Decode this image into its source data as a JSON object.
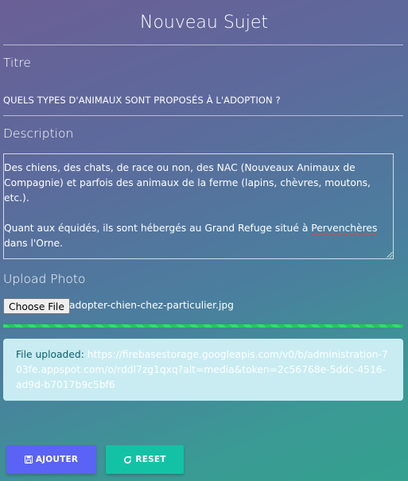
{
  "page": {
    "title": "Nouveau Sujet"
  },
  "form": {
    "titre_label": "Titre",
    "titre_value": "QUELS TYPES D'ANIMAUX SONT PROPOSÉS À L'ADOPTION ?",
    "description_label": "Description",
    "description_p1": "Des chiens, des chats, de race ou non, des NAC (Nouveaux Animaux de Compagnie) et parfois des animaux de la ferme (lapins, chèvres, moutons, etc.).",
    "description_p2_before": "Quant aux équidés, ils sont hébergés au Grand Refuge situé à ",
    "description_p2_misspelled": "Pervenchères",
    "description_p2_after": " dans l'Orne.",
    "upload_label": "Upload Photo",
    "choose_file_label": "Choose File",
    "file_name": "adopter-chien-chez-particulier.jpg",
    "upload_progress_percent": 100
  },
  "alert": {
    "prefix": "File uploaded: ",
    "url": "https://firebasestorage.googleapis.com/v0/b/administration-703fe.appspot.com/o/rddl7zg1qxq?alt=media&token=2c56768e-5ddc-4516-ad9d-b7017b9c5bf6"
  },
  "buttons": {
    "add_label": "AJOUTER",
    "add_icon": "save-icon",
    "reset_label": "RESET",
    "reset_icon": "refresh-icon"
  },
  "colors": {
    "add_button": "#5a63f5",
    "reset_button": "#13c2a4",
    "progress": "#2ee06b",
    "alert_bg": "#c9ecf2"
  }
}
